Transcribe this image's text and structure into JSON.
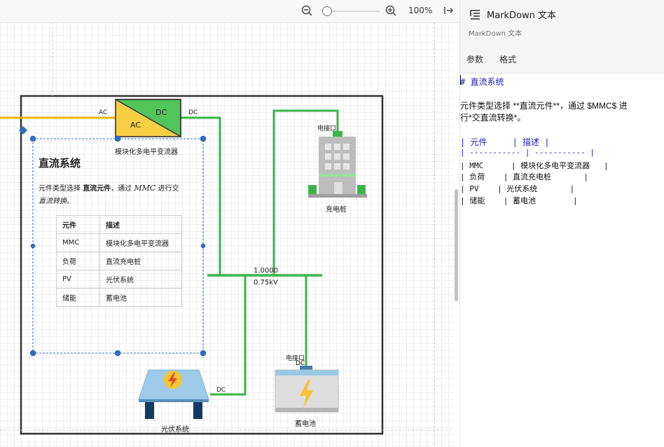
{
  "toolbar": {
    "zoom_value": "100%",
    "zoom_out_icon": "zoom-out-icon",
    "zoom_in_icon": "zoom-in-icon",
    "collapse_icon": "panel-collapse-icon"
  },
  "panel": {
    "title": "MarkDown 文本",
    "subtitle": "MarkDown 文本",
    "tabs": [
      "参数",
      "格式"
    ],
    "md_lines": [
      "# 直流系统",
      "",
      "元件类型选择 **直流元件**，通过 $MMC$ 进",
      "行*交直流转换*。",
      "",
      "| 元件     | 描述 |",
      "| ----------- | ----------- |",
      "| MMC      | 模块化多电平变流器   |",
      "| 负荷    | 直流充电桩       |",
      "| PV    | 光伏系统       |",
      "| 储能    | 蓄电池        |"
    ]
  },
  "diagram": {
    "note": {
      "title": "直流系统",
      "para_prefix": "元件类型选择 ",
      "para_bold": "直流元件",
      "para_mid": "，通过 ",
      "para_math": "MMC",
      "para_suffix": " 进行交",
      "para_italic": "直流转换",
      "para_end": "。",
      "table_headers": [
        "元件",
        "描述"
      ],
      "table_rows": [
        [
          "MMC",
          "模块化多电平变流器"
        ],
        [
          "负荷",
          "直流充电桩"
        ],
        [
          "PV",
          "光伏系统"
        ],
        [
          "储能",
          "蓄电池"
        ]
      ]
    },
    "mmc_label": "模块化多电平变流器",
    "mmc_ac": "AC",
    "mmc_dc": "DC",
    "port_ac": "AC",
    "port_dc": "DC",
    "charger_label": "充电桩",
    "charger_port": "电接口",
    "bus_value": "1.0000",
    "bus_voltage": "0.75kV",
    "pv_label": "光伏系统",
    "pv_port": "DC",
    "battery_label": "蓄电池",
    "battery_port": "电接口",
    "battery_port_dc": "DC"
  },
  "colors": {
    "line_green": "#3cb44b",
    "line_yellow": "#e8b800",
    "selection_blue": "#2f6fc4",
    "mmc_green": "#52c55a",
    "mmc_yellow": "#f7cf45"
  }
}
